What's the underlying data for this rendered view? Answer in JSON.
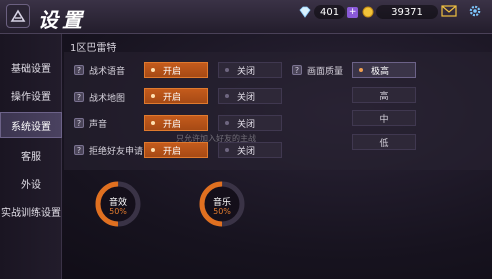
{
  "header": {
    "title": "设置",
    "diamonds": "401",
    "gold": "39371"
  },
  "sidebar": {
    "items": [
      {
        "label": "基础设置"
      },
      {
        "label": "操作设置"
      },
      {
        "label": "系统设置",
        "active": true
      },
      {
        "label": "客服"
      },
      {
        "label": "外设"
      },
      {
        "label": "实战训练设置"
      }
    ]
  },
  "main": {
    "server": "1区巴雷特",
    "rows": [
      {
        "label": "战术语音",
        "on": "开启",
        "off": "关闭",
        "checked": true
      },
      {
        "label": "战术地图",
        "on": "开启",
        "off": "关闭",
        "checked": true
      },
      {
        "label": "声音",
        "on": "开启",
        "off": "关闭",
        "checked": true
      },
      {
        "label": "拒绝好友申请",
        "on": "开启",
        "off": "关闭",
        "checked": false
      }
    ],
    "quality": {
      "label": "画面质量",
      "options": [
        "极高",
        "高",
        "中",
        "低"
      ],
      "selected": "极高"
    },
    "dials": [
      {
        "label": "音效",
        "value": "50%",
        "level": 0.5
      },
      {
        "label": "音乐",
        "value": "50%",
        "level": 0.5
      }
    ],
    "toast": "只允许加入好友的主战"
  },
  "colors": {
    "accent": "#d96a24",
    "active_tab": "#4a4260",
    "background": "#17131f"
  }
}
